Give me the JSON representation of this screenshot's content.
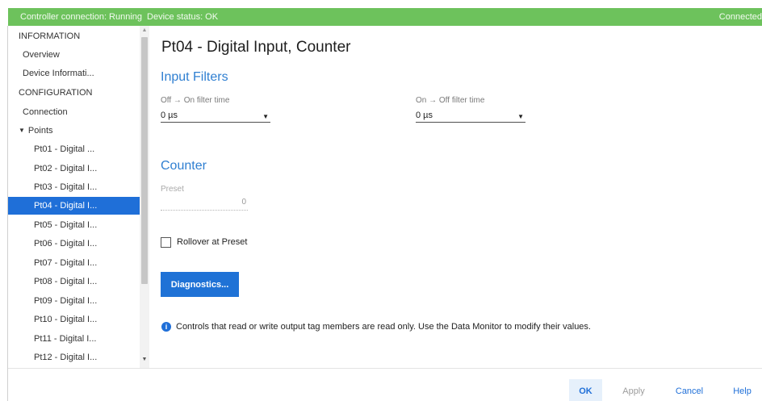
{
  "status_bar": {
    "controller": "Controller connection: Running",
    "device": "Device status: OK",
    "right": "Connected"
  },
  "sidebar": {
    "items": [
      {
        "label": "INFORMATION",
        "level": 0
      },
      {
        "label": "Overview",
        "level": 1
      },
      {
        "label": "Device Informati...",
        "level": 1
      },
      {
        "label": "CONFIGURATION",
        "level": 0
      },
      {
        "label": "Connection",
        "level": 1
      },
      {
        "label": "Points",
        "level": 1,
        "expanded": true
      },
      {
        "label": "Pt01 - Digital ...",
        "level": 2
      },
      {
        "label": "Pt02 - Digital I...",
        "level": 2
      },
      {
        "label": "Pt03 - Digital I...",
        "level": 2
      },
      {
        "label": "Pt04 - Digital I...",
        "level": 2,
        "selected": true
      },
      {
        "label": "Pt05 - Digital I...",
        "level": 2
      },
      {
        "label": "Pt06 - Digital I...",
        "level": 2
      },
      {
        "label": "Pt07 - Digital I...",
        "level": 2
      },
      {
        "label": "Pt08 - Digital I...",
        "level": 2
      },
      {
        "label": "Pt09 - Digital I...",
        "level": 2
      },
      {
        "label": "Pt10 - Digital I...",
        "level": 2
      },
      {
        "label": "Pt11 - Digital I...",
        "level": 2
      },
      {
        "label": "Pt12 - Digital I...",
        "level": 2
      }
    ]
  },
  "main": {
    "title": "Pt04 - Digital Input, Counter",
    "input_filters": {
      "heading": "Input Filters",
      "off_on_label": "Off → On filter time",
      "off_on_value": "0 µs",
      "on_off_label": "On → Off filter time",
      "on_off_value": "0 µs"
    },
    "counter": {
      "heading": "Counter",
      "preset_label": "Preset",
      "preset_value": "0",
      "rollover_label": "Rollover at Preset",
      "rollover_checked": false
    },
    "diagnostics_label": "Diagnostics...",
    "info_text": "Controls that read or write output tag members are read only. Use the Data Monitor to modify their values."
  },
  "footer": {
    "ok": "OK",
    "apply": "Apply",
    "cancel": "Cancel",
    "help": "Help"
  },
  "colors": {
    "status_bar": "#6dc25c",
    "accent": "#1f6fd8",
    "section_heading": "#2f7fd1"
  },
  "icons": {
    "expand": "triangle-down-icon",
    "info": "info-icon",
    "select_caret": "caret-down-icon"
  }
}
